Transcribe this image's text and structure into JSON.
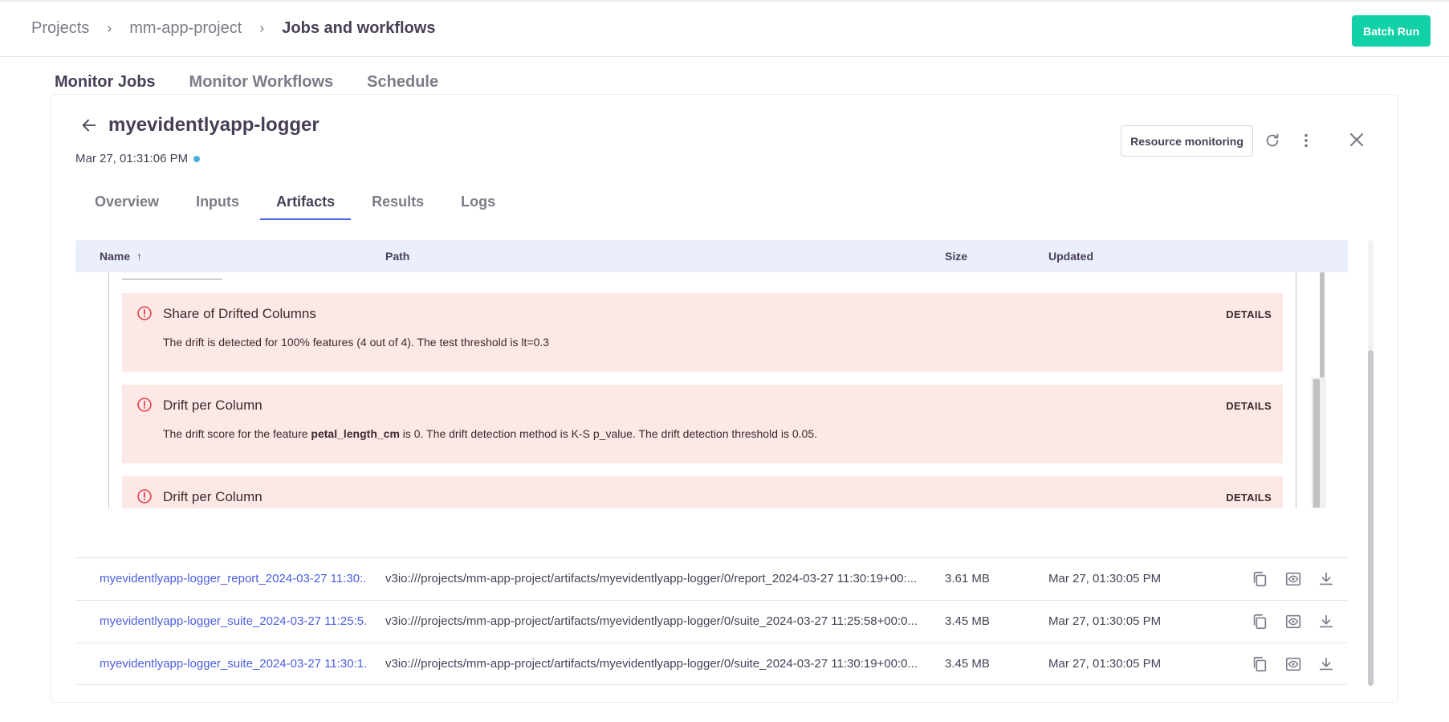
{
  "breadcrumb": {
    "items": [
      "Projects",
      "mm-app-project",
      "Jobs and workflows"
    ],
    "separator": "›"
  },
  "header": {
    "batch_run_label": "Batch Run"
  },
  "main_tabs": [
    "Monitor Jobs",
    "Monitor Workflows",
    "Schedule"
  ],
  "job": {
    "title": "myevidentlyapp-logger",
    "date": "Mar 27, 01:31:06 PM",
    "resource_monitoring_label": "Resource monitoring"
  },
  "sub_tabs": [
    "Overview",
    "Inputs",
    "Artifacts",
    "Results",
    "Logs"
  ],
  "table": {
    "headers": {
      "name": "Name",
      "path": "Path",
      "size": "Size",
      "updated": "Updated"
    },
    "sort_arrow": "↑",
    "rows": [
      {
        "name": "myevidentlyapp-logger_report_2024-03-27 11:30:...",
        "path": "v3io:///projects/mm-app-project/artifacts/myevidentlyapp-logger/0/report_2024-03-27 11:30:19+00:...",
        "size": "3.61 MB",
        "updated": "Mar 27, 01:30:05 PM"
      },
      {
        "name": "myevidentlyapp-logger_suite_2024-03-27 11:25:5...",
        "path": "v3io:///projects/mm-app-project/artifacts/myevidentlyapp-logger/0/suite_2024-03-27 11:25:58+00:0...",
        "size": "3.45 MB",
        "updated": "Mar 27, 01:30:05 PM"
      },
      {
        "name": "myevidentlyapp-logger_suite_2024-03-27 11:30:1...",
        "path": "v3io:///projects/mm-app-project/artifacts/myevidentlyapp-logger/0/suite_2024-03-27 11:30:19+00:0...",
        "size": "3.45 MB",
        "updated": "Mar 27, 01:30:05 PM"
      }
    ]
  },
  "preview": {
    "tests": [
      {
        "title": "Share of Drifted Columns",
        "details": "DETAILS",
        "desc_pre": "The drift is detected for 100% features (4 out of 4). The test threshold is lt=0.3",
        "desc_bold": "",
        "desc_post": ""
      },
      {
        "title": "Drift per Column",
        "details": "DETAILS",
        "desc_pre": "The drift score for the feature ",
        "desc_bold": "petal_length_cm",
        "desc_post": " is 0. The drift detection method is K-S p_value. The drift detection threshold is 0.05."
      },
      {
        "title": "Drift per Column",
        "details": "DETAILS",
        "desc_pre": "",
        "desc_bold": "",
        "desc_post": ""
      }
    ]
  },
  "colors": {
    "accent": "#4b5fe0",
    "batch_run": "#13d1a6",
    "fail_card": "#fde8e8",
    "fail_icon": "#e5484d",
    "status_dot": "#49afd9"
  }
}
